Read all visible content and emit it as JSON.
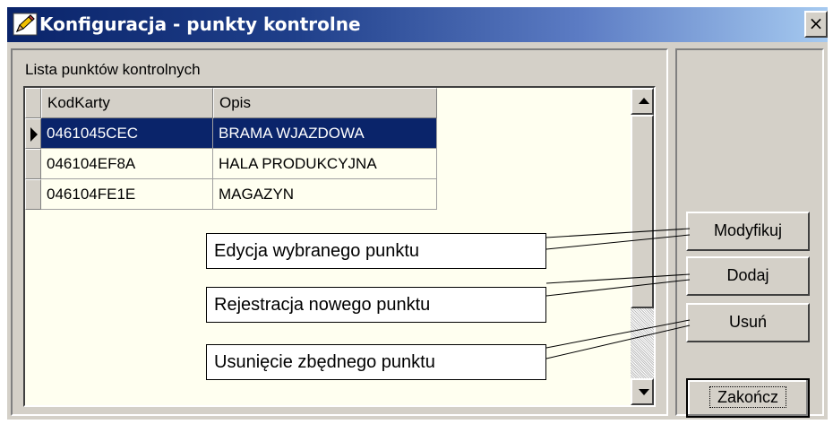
{
  "window": {
    "title": "Konfiguracja - punkty kontrolne",
    "close_glyph": "×",
    "icon": "pencil-icon",
    "titlebar_colors": [
      "#0a246a",
      "#a6caf0"
    ]
  },
  "group": {
    "label": "Lista punktów kontrolnych"
  },
  "grid": {
    "columns": [
      "KodKarty",
      "Opis"
    ],
    "rows": [
      {
        "kod": "0461045CEC",
        "opis": "BRAMA WJAZDOWA",
        "selected": true
      },
      {
        "kod": "046104EF8A",
        "opis": "HALA PRODUKCYJNA",
        "selected": false
      },
      {
        "kod": "046104FE1E",
        "opis": "MAGAZYN",
        "selected": false
      }
    ],
    "selection_color": "#0a246a",
    "background_color": "#fffff0"
  },
  "buttons": {
    "modify": "Modyfikuj",
    "add": "Dodaj",
    "delete": "Usuń",
    "close": "Zakończ"
  },
  "callouts": {
    "modify": "Edycja wybranego punktu",
    "add": "Rejestracja nowego punktu",
    "delete": "Usunięcie zbędnego punktu"
  }
}
